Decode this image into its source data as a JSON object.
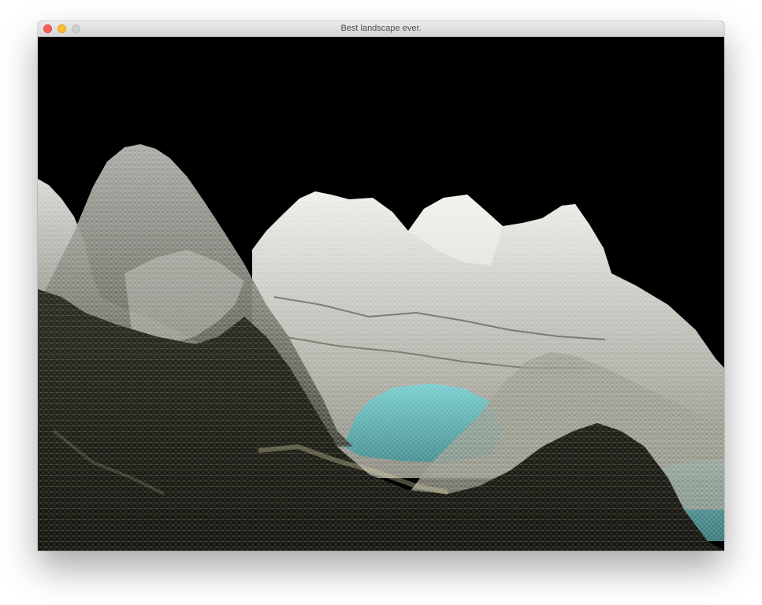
{
  "window": {
    "title": "Best landscape ever."
  },
  "traffic_lights": [
    {
      "name": "close-button",
      "color": "#fd5f57"
    },
    {
      "name": "minimize-button",
      "color": "#febc2e"
    },
    {
      "name": "zoom-button",
      "color": "#cfcfcf"
    }
  ],
  "scene": {
    "description_icon": "wireframe-terrain",
    "colors": {
      "background": "#000000",
      "far_mountains": "#d6d6d0",
      "near_mountain": "#bdbdb6",
      "foreground": "#1d1d18",
      "lake": "#6fb7b9",
      "grid_line": "#e8e6c8"
    }
  }
}
